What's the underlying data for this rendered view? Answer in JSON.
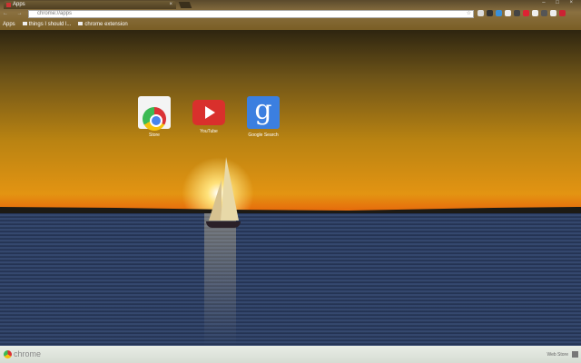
{
  "tab": {
    "title": "Apps",
    "close": "×"
  },
  "window_controls": "– □ ×",
  "nav": "← → ⟳",
  "omnibox": {
    "url": "chrome://apps",
    "star": "☆"
  },
  "extensions": [
    "#ddd",
    "#333",
    "#3a8fd8",
    "#eee",
    "#444",
    "#d23",
    "#eee",
    "#555",
    "#eee",
    "#c23"
  ],
  "bookmarks": [
    {
      "label": "Apps"
    },
    {
      "label": "things I should l..."
    },
    {
      "label": "chrome extension"
    }
  ],
  "apps": [
    {
      "label": "Store"
    },
    {
      "label": "YouTube"
    },
    {
      "label": "Google Search",
      "glyph": "g"
    }
  ],
  "footer": {
    "brand": "chrome",
    "webstore": "Web Store"
  }
}
